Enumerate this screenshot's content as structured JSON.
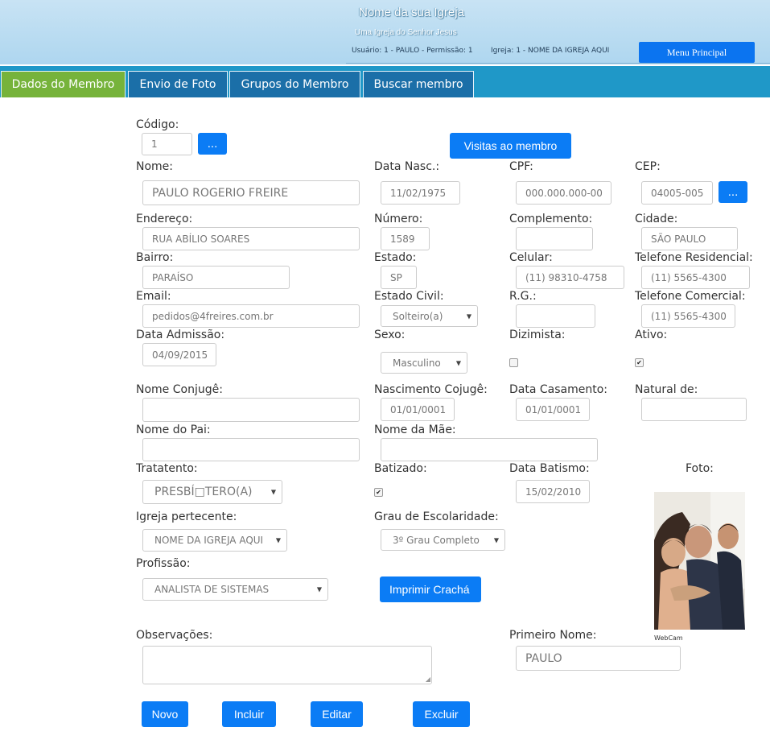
{
  "header": {
    "church_name": "Nome da sua Igreja",
    "church_subtitle": "Uma Igreja do Senhor Jesus",
    "user_info": "Usuário: 1 - PAULO - Permissão: 1",
    "church_info": "Igreja: 1 - NOME DA IGREJA AQUI",
    "menu_button": "Menu Principal"
  },
  "tabs": [
    "Dados do Membro",
    "Envio de Foto",
    "Grupos do Membro",
    "Buscar membro"
  ],
  "form": {
    "codigo": {
      "label": "Código:",
      "value": "1",
      "lookup_button": "..."
    },
    "visitas_button": "Visitas ao membro",
    "nome": {
      "label": "Nome:",
      "value": "PAULO ROGERIO FREIRE"
    },
    "data_nasc": {
      "label": "Data Nasc.:",
      "value": "11/02/1975"
    },
    "cpf": {
      "label": "CPF:",
      "value": "000.000.000-00"
    },
    "cep": {
      "label": "CEP:",
      "value": "04005-005",
      "lookup_button": "..."
    },
    "endereco": {
      "label": "Endereço:",
      "value": "RUA ABÍLIO SOARES"
    },
    "numero": {
      "label": "Número:",
      "value": "1589"
    },
    "complemento": {
      "label": "Complemento:",
      "value": ""
    },
    "cidade": {
      "label": "Cidade:",
      "value": "SÃO PAULO"
    },
    "bairro": {
      "label": "Bairro:",
      "value": "PARAÍSO"
    },
    "estado": {
      "label": "Estado:",
      "value": "SP"
    },
    "celular": {
      "label": "Celular:",
      "value": "(11) 98310-4758"
    },
    "telefone_residencial": {
      "label": "Telefone Residencial:",
      "value": "(11) 5565-4300"
    },
    "email": {
      "label": "Email:",
      "value": "pedidos@4freires.com.br"
    },
    "estado_civil": {
      "label": "Estado Civil:",
      "value": "Solteiro(a)"
    },
    "rg": {
      "label": "R.G.:",
      "value": ""
    },
    "telefone_comercial": {
      "label": "Telefone Comercial:",
      "value": "(11) 5565-4300"
    },
    "data_admissao": {
      "label": "Data Admissão:",
      "value": "04/09/2015"
    },
    "sexo": {
      "label": "Sexo:",
      "value": "Masculino"
    },
    "dizimista": {
      "label": "Dizimista:",
      "checked": false
    },
    "ativo": {
      "label": "Ativo:",
      "checked": true
    },
    "nome_conjuge": {
      "label": "Nome Conjugê:",
      "value": ""
    },
    "nascimento_conjuge": {
      "label": "Nascimento Cojugê:",
      "value": "01/01/0001"
    },
    "data_casamento": {
      "label": "Data Casamento:",
      "value": "01/01/0001"
    },
    "natural_de": {
      "label": "Natural de:",
      "value": ""
    },
    "nome_pai": {
      "label": "Nome do Pai:",
      "value": ""
    },
    "nome_mae": {
      "label": "Nome da Mãe:",
      "value": ""
    },
    "tratamento": {
      "label": "Tratatento:",
      "value": "PRESBÍ□TERO(A)"
    },
    "batizado": {
      "label": "Batizado:",
      "checked": true
    },
    "data_batismo": {
      "label": "Data Batismo:",
      "value": "15/02/2010"
    },
    "foto": {
      "label": "Foto:",
      "caption": "WebCam"
    },
    "igreja_pertencente": {
      "label": "Igreja pertecente:",
      "value": "NOME DA IGREJA AQUI"
    },
    "grau_escolaridade": {
      "label": "Grau de Escolaridade:",
      "value": "3º Grau Completo"
    },
    "profissao": {
      "label": "Profissão:",
      "value": "ANALISTA DE SISTEMAS"
    },
    "imprimir_button": "Imprimir Crachá",
    "observacoes": {
      "label": "Observações:",
      "value": ""
    },
    "primeiro_nome": {
      "label": "Primeiro Nome:",
      "value": "PAULO"
    }
  },
  "actions": {
    "novo": "Novo",
    "incluir": "Incluir",
    "editar": "Editar",
    "excluir": "Excluir"
  },
  "colors": {
    "primary_button": "#0b7cf5",
    "active_tab": "#76b33b",
    "tab": "#1b6fa8",
    "tabbar": "#1f98c8"
  }
}
